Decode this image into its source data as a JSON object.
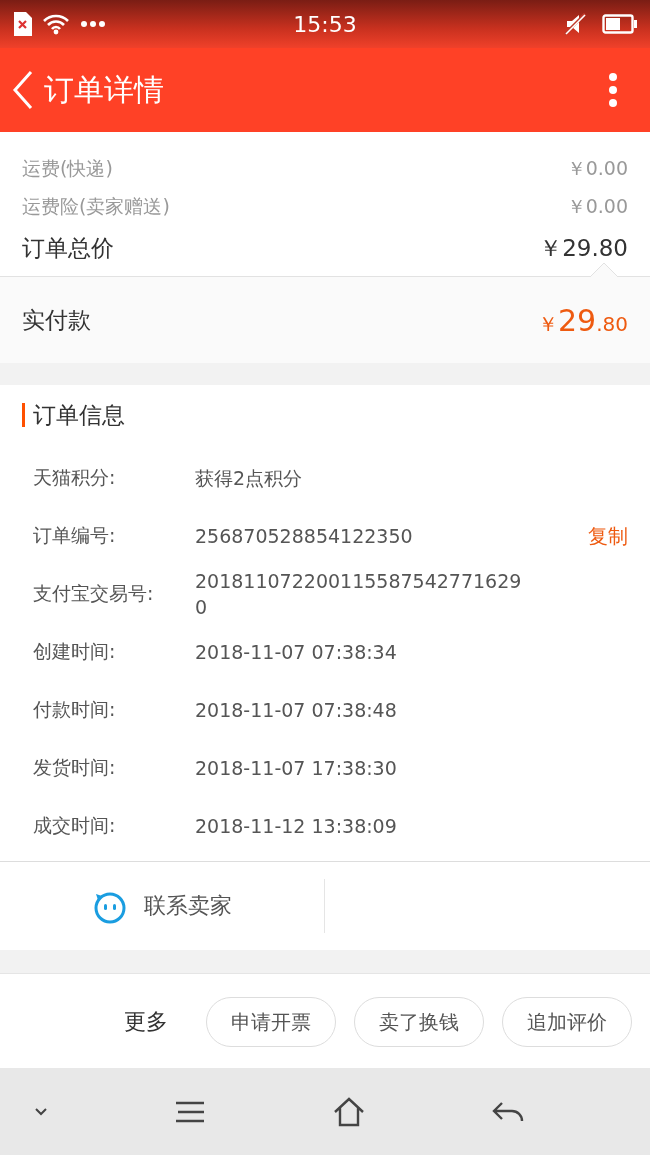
{
  "status_bar": {
    "time": "15:53"
  },
  "header": {
    "title": "订单详情"
  },
  "price_rows": [
    {
      "label": "运费(快递)",
      "value": "￥0.00",
      "kind": "minor"
    },
    {
      "label": "运费险(卖家赠送)",
      "value": "￥0.00",
      "kind": "minor"
    },
    {
      "label": "订单总价",
      "value": "￥29.80",
      "kind": "total"
    }
  ],
  "paid": {
    "label": "实付款",
    "currency": "￥",
    "integer": "29",
    "decimal": ".80"
  },
  "order_info": {
    "title": "订单信息",
    "rows": [
      {
        "label": "天猫积分:",
        "value": "获得2点积分"
      },
      {
        "label": "订单编号:",
        "value": "256870528854122350",
        "action": "复制"
      },
      {
        "label": "支付宝交易号:",
        "value": "2018110722001155875427716290"
      },
      {
        "label": "创建时间:",
        "value": "2018-11-07 07:38:34"
      },
      {
        "label": "付款时间:",
        "value": "2018-11-07 07:38:48"
      },
      {
        "label": "发货时间:",
        "value": "2018-11-07 17:38:30"
      },
      {
        "label": "成交时间:",
        "value": "2018-11-12 13:38:09"
      }
    ]
  },
  "contact": {
    "label": "联系卖家"
  },
  "actions": {
    "more": "更多",
    "buttons": [
      "申请开票",
      "卖了换钱",
      "追加评价"
    ]
  }
}
